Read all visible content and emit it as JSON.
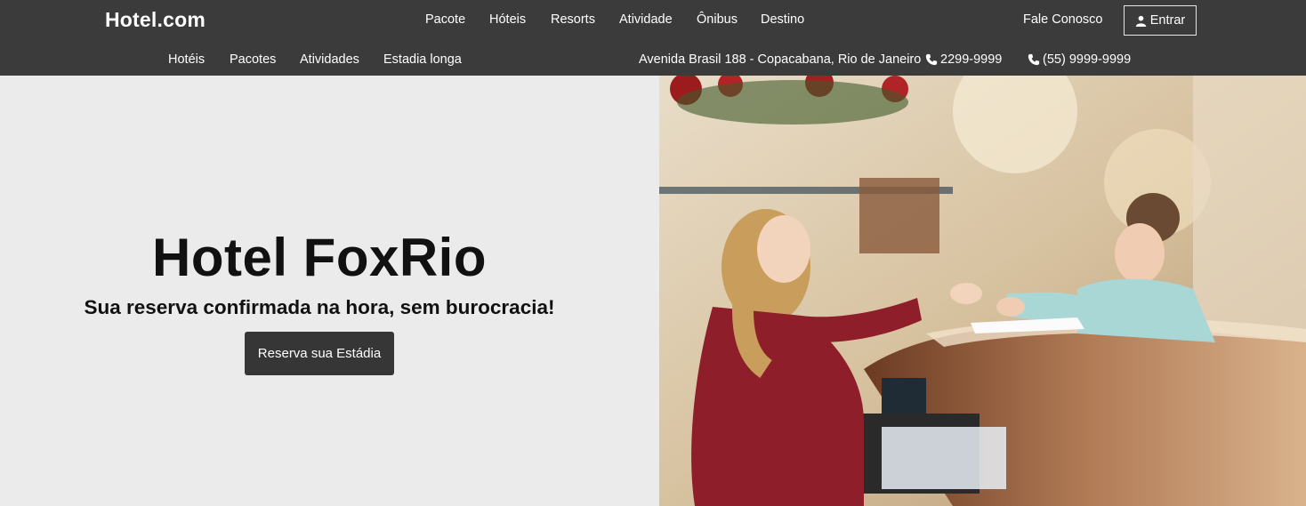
{
  "header": {
    "brand": "Hotel.com",
    "main_nav": [
      "Pacote",
      "Hóteis",
      "Resorts",
      "Atividade",
      "Ônibus",
      "Destino"
    ],
    "contact_label": "Fale Conosco",
    "login_label": "Entrar",
    "login_icon": "user-icon",
    "sub_nav": [
      "Hotéis",
      "Pacotes",
      "Atividades",
      "Estadia longa"
    ],
    "address": "Avenida Brasil 188 - Copacabana, Rio de Janeiro",
    "phones": [
      "2299-9999",
      "(55) 9999-9999"
    ],
    "phone_icon": "phone-icon"
  },
  "hero": {
    "title": "Hotel FoxRio",
    "subtitle": "Sua reserva confirmada na hora, sem burocracia!",
    "cta_label": "Reserva sua Estádia",
    "image_alt": "receptionist-and-guest-at-hotel-front-desk"
  },
  "colors": {
    "header_bg": "#3b3b3b",
    "hero_bg": "#ebebeb",
    "button_bg": "#363636",
    "uniform_red": "#8e1e2a"
  }
}
